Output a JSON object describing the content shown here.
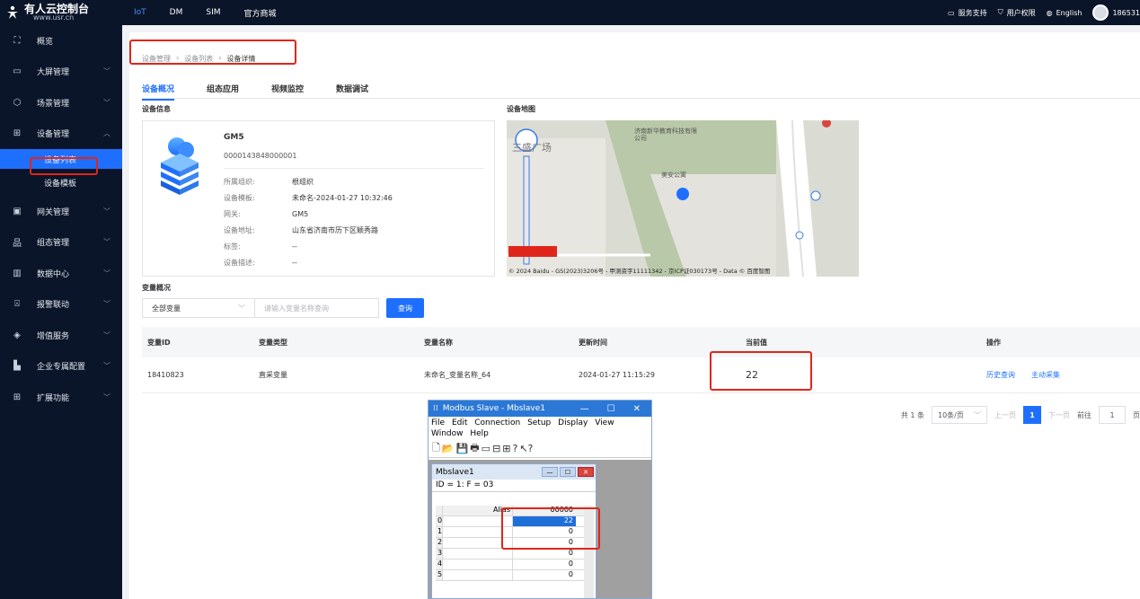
{
  "topbar": {
    "logo_title": "有人云控制台",
    "logo_sub": "www.usr.cn",
    "tabs": [
      "IoT",
      "DM",
      "SIM",
      "官方商城"
    ],
    "support": "服务支持",
    "permission": "用户权限",
    "language": "English",
    "user": "186531"
  },
  "sidebar": {
    "items": [
      {
        "label": "概览",
        "icon": "scan-icon"
      },
      {
        "label": "大屏管理",
        "icon": "monitor-icon"
      },
      {
        "label": "场景管理",
        "icon": "cube-icon"
      },
      {
        "label": "设备管理",
        "icon": "device-icon"
      },
      {
        "label": "网关管理",
        "icon": "gateway-icon"
      },
      {
        "label": "组态管理",
        "icon": "topology-icon"
      },
      {
        "label": "数据中心",
        "icon": "chart-icon"
      },
      {
        "label": "报警联动",
        "icon": "alarm-icon"
      },
      {
        "label": "增值服务",
        "icon": "diamond-icon"
      },
      {
        "label": "企业专属配置",
        "icon": "enterprise-icon"
      },
      {
        "label": "扩展功能",
        "icon": "grid-icon"
      }
    ],
    "sub": [
      "设备列表",
      "设备模板"
    ]
  },
  "breadcrumb": [
    "设备管理",
    "设备列表",
    "设备详情"
  ],
  "tabs": [
    "设备概况",
    "组态应用",
    "视频监控",
    "数据调试"
  ],
  "device_info": {
    "section_title": "设备信息",
    "name": "GM5",
    "id": "0000143848000001",
    "fields": [
      {
        "k": "所属组织:",
        "v": "根组织"
      },
      {
        "k": "设备模板:",
        "v": "未命名-2024-01-27 10:32:46"
      },
      {
        "k": "网关:",
        "v": "GM5"
      },
      {
        "k": "设备地址:",
        "v": "山东省济南市历下区颖秀路"
      },
      {
        "k": "标签:",
        "v": "--"
      },
      {
        "k": "设备描述:",
        "v": "--"
      }
    ]
  },
  "map": {
    "section_title": "设备地图",
    "poi1": "济南新华教育科技有限公司",
    "poi2": "美安公寓",
    "place": "三盛广场",
    "copyright": "© 2024 Baidu - GS(2023)3206号 - 甲测资字11111342 - 京ICP证030173号 - Data © 百度智图"
  },
  "variables": {
    "section_title": "变量概况",
    "filter_value": "全部变量",
    "search_placeholder": "请输入变量名称查询",
    "query_button": "查询",
    "headers": [
      "变量ID",
      "变量类型",
      "变量名称",
      "更新时间",
      "当前值",
      "操作"
    ],
    "rows": [
      {
        "id": "18410823",
        "type": "直采变量",
        "name": "未命名_变量名称_64",
        "time": "2024-01-27 11:15:29",
        "value": "22",
        "op1": "历史查询",
        "op2": "主动采集"
      }
    ]
  },
  "pager": {
    "total": "共 1 条",
    "page_size": "10条/页",
    "prev": "上一页",
    "current": "1",
    "next": "下一页",
    "goto": "前往",
    "goto_value": "1",
    "page_unit": "页"
  },
  "modbus": {
    "title": "Modbus Slave - Mbslave1",
    "menu": [
      "File",
      "Edit",
      "Connection",
      "Setup",
      "Display",
      "View",
      "Window",
      "Help"
    ],
    "child_title": "Mbslave1",
    "id_line": "ID = 1: F = 03",
    "col_alias": "Alias",
    "col_addr": "00000",
    "rows": [
      {
        "i": "0",
        "v": "22"
      },
      {
        "i": "1",
        "v": "0"
      },
      {
        "i": "2",
        "v": "0"
      },
      {
        "i": "3",
        "v": "0"
      },
      {
        "i": "4",
        "v": "0"
      },
      {
        "i": "5",
        "v": "0"
      }
    ]
  },
  "colors": {
    "accent": "#1f6fff",
    "highlight": "#e0261b",
    "sidebar": "#0b1529"
  }
}
